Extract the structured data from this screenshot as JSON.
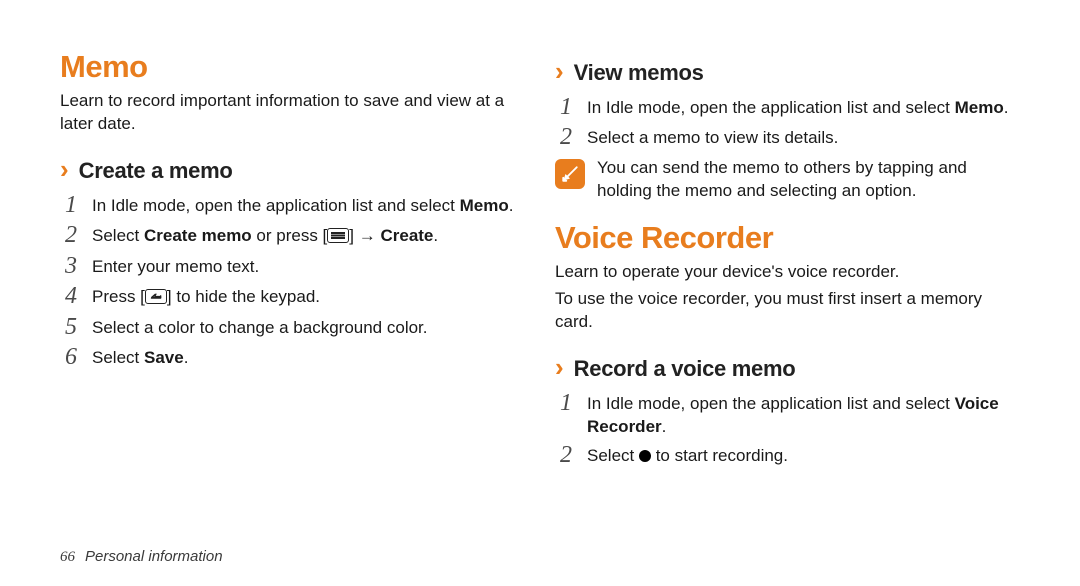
{
  "col_left": {
    "h1": "Memo",
    "intro": "Learn to record important information to save and view at a later date.",
    "sub_create": "Create a memo",
    "steps": [
      {
        "n": "1",
        "pre": "In Idle mode, open the application list and select ",
        "bold": "Memo",
        "post": "."
      },
      {
        "n": "2",
        "pre": "Select ",
        "b1": "Create memo",
        "mid": " or press [",
        "icon": "menu",
        "post1": "] → ",
        "b2": "Create",
        "post2": "."
      },
      {
        "n": "3",
        "txt": "Enter your memo text."
      },
      {
        "n": "4",
        "pre": "Press [",
        "icon": "back",
        "post": "] to hide the keypad."
      },
      {
        "n": "5",
        "txt": "Select a color to change a background color."
      },
      {
        "n": "6",
        "pre": "Select ",
        "bold": "Save",
        "post": "."
      }
    ]
  },
  "col_right": {
    "sub_view": "View memos",
    "view_steps": [
      {
        "n": "1",
        "pre": "In Idle mode, open the application list and select ",
        "bold": "Memo",
        "post": "."
      },
      {
        "n": "2",
        "txt": "Select a memo to view its details."
      }
    ],
    "note": "You can send the memo to others by tapping and holding the memo and selecting an option.",
    "h1_voice": "Voice Recorder",
    "voice_intro1": "Learn to operate your device's voice recorder.",
    "voice_intro2": "To use the voice recorder, you must first insert a memory card.",
    "sub_record": "Record a voice memo",
    "record_steps": [
      {
        "n": "1",
        "pre": "In Idle mode, open the application list and select ",
        "bold": "Voice Recorder",
        "post": "."
      },
      {
        "n": "2",
        "pre": "Select ",
        "icon": "dot",
        "post": " to start recording."
      }
    ]
  },
  "footer": {
    "page": "66",
    "section": "Personal information"
  }
}
